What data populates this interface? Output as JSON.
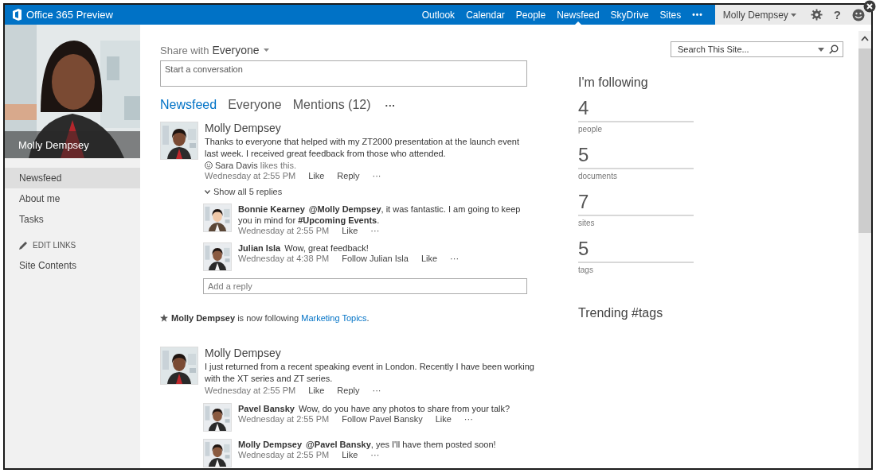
{
  "topbar": {
    "brand": "Office 365 Preview",
    "nav": [
      {
        "label": "Outlook",
        "selected": false
      },
      {
        "label": "Calendar",
        "selected": false
      },
      {
        "label": "People",
        "selected": false
      },
      {
        "label": "Newsfeed",
        "selected": true
      },
      {
        "label": "SkyDrive",
        "selected": false
      },
      {
        "label": "Sites",
        "selected": false
      }
    ],
    "more": "•••",
    "user": "Molly Dempsey",
    "help": "?"
  },
  "profile": {
    "name": "Molly Dempsey"
  },
  "sidebar": {
    "items": [
      {
        "label": "Newsfeed",
        "selected": true
      },
      {
        "label": "About me",
        "selected": false
      },
      {
        "label": "Tasks",
        "selected": false
      }
    ],
    "edit_links": "EDIT LINKS",
    "links": [
      "Site Contents"
    ]
  },
  "share": {
    "label": "Share with",
    "audience": "Everyone",
    "placeholder": "Start a conversation"
  },
  "feed_tabs": [
    {
      "label": "Newsfeed",
      "selected": true
    },
    {
      "label": "Everyone",
      "selected": false
    },
    {
      "label": "Mentions (12)",
      "selected": false
    }
  ],
  "feed_more": "···",
  "feed": [
    {
      "kind": "post",
      "author": "Molly Dempsey",
      "text": "Thanks to everyone that helped with my ZT2000 presentation at the launch event last week. I received great feedback from those who attended.",
      "likes": {
        "name": "Sara Davis",
        "text": "likes this."
      },
      "time": "Wednesday at 2:55 PM",
      "actions": [
        "Like",
        "Reply",
        "···"
      ],
      "show_replies": "Show all 5 replies",
      "replies": [
        {
          "author": "Bonnie Kearney",
          "text": "**@Molly Dempsey**, it was fantastic. I am going to keep you in mind for **#Upcoming Events**.",
          "time": "Wednesday at 2:55 PM",
          "actions": [
            "Like",
            "···"
          ]
        },
        {
          "author": "Julian Isla",
          "text": "Wow, great feedback!",
          "time": "Wednesday at 4:38 PM",
          "actions": [
            "Follow Julian Isla",
            "Like",
            "···"
          ]
        }
      ],
      "reply_placeholder": "Add a reply"
    },
    {
      "kind": "activity",
      "text": "**Molly Dempsey** is now following",
      "link": "Marketing Topics",
      "end": "."
    },
    {
      "kind": "post",
      "author": "Molly Dempsey",
      "text": "I just returned from a recent speaking event in London.  Recently I have been working with the XT series and ZT series.",
      "time": "Wednesday at 2:55 PM",
      "actions": [
        "Like",
        "Reply",
        "···"
      ],
      "replies": [
        {
          "author": "Pavel Bansky",
          "text": "Wow, do you have any photos to share from your talk?",
          "time": "Wednesday at 2:55 PM",
          "actions": [
            "Follow Pavel Bansky",
            "Like",
            "···"
          ]
        },
        {
          "author": "Molly Dempsey",
          "text": "**@Pavel Bansky**, yes I'll have them posted soon!",
          "time": "Wednesday at 2:55 PM",
          "actions": [
            "Like",
            "···"
          ]
        }
      ]
    }
  ],
  "search": {
    "placeholder": "Search This Site..."
  },
  "following": {
    "title": "I'm following",
    "stats": [
      {
        "count": "4",
        "label": "people"
      },
      {
        "count": "5",
        "label": "documents"
      },
      {
        "count": "7",
        "label": "sites"
      },
      {
        "count": "5",
        "label": "tags"
      }
    ]
  },
  "trending": {
    "title": "Trending #tags"
  }
}
